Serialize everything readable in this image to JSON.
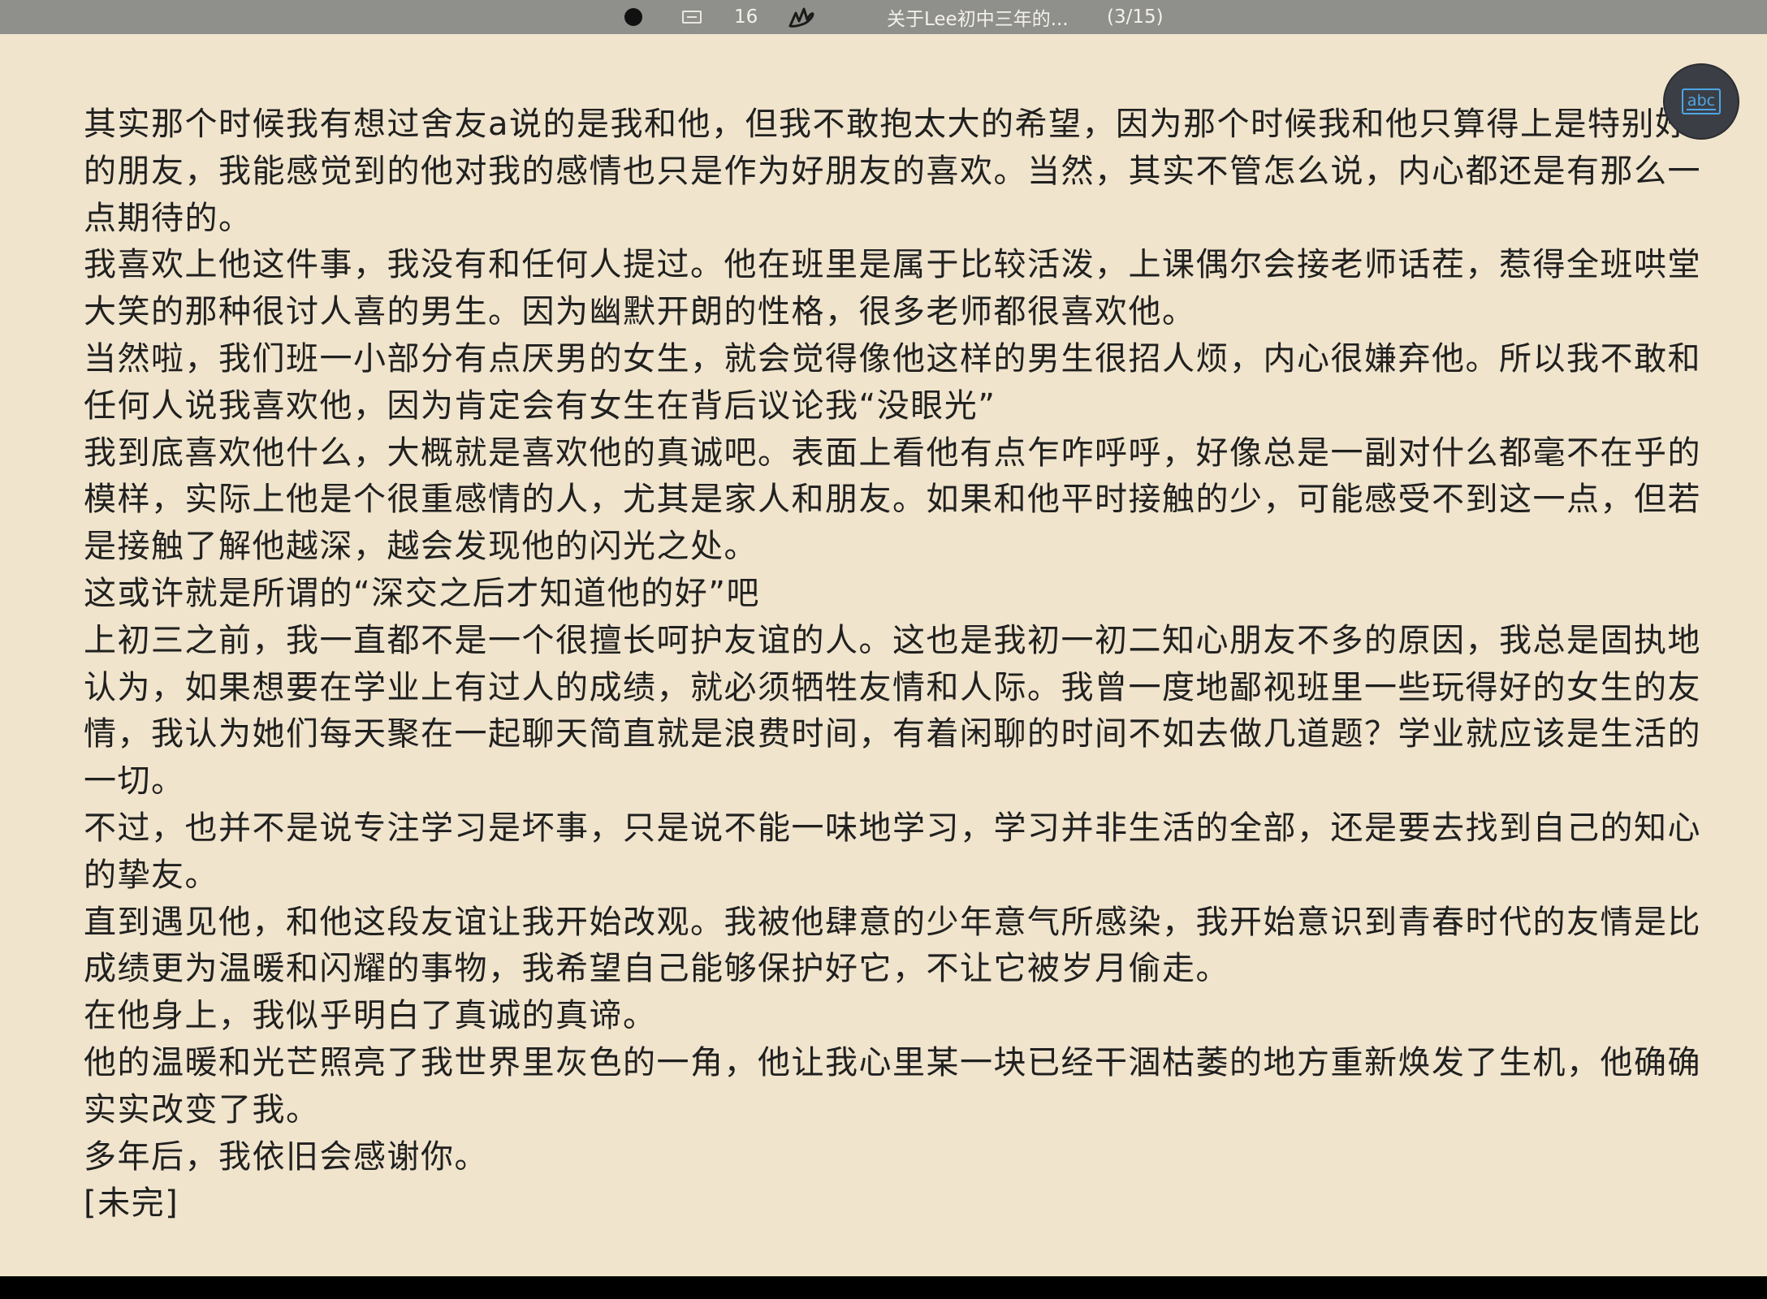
{
  "status_bar": {
    "signature_count": "16",
    "document_title": "关于Lee初中三年的...",
    "page_indicator": "(3/15)"
  },
  "float_button": {
    "label": "abc",
    "icon": "text-recognition-icon",
    "accent_color": "#4ea6e6"
  },
  "content": {
    "paragraphs": [
      "其实那个时候我有想过舍友a说的是我和他，但我不敢抱太大的希望，因为那个时候我和他只算得上是特别好的朋友，我能感觉到的他对我的感情也只是作为好朋友的喜欢。当然，其实不管怎么说，内心都还是有那么一点期待的。",
      "我喜欢上他这件事，我没有和任何人提过。他在班里是属于比较活泼，上课偶尔会接老师话茬，惹得全班哄堂大笑的那种很讨人喜的男生。因为幽默开朗的性格，很多老师都很喜欢他。",
      "当然啦，我们班一小部分有点厌男的女生，就会觉得像他这样的男生很招人烦，内心很嫌弃他。所以我不敢和任何人说我喜欢他，因为肯定会有女生在背后议论我“没眼光”",
      "我到底喜欢他什么，大概就是喜欢他的真诚吧。表面上看他有点乍咋呼呼，好像总是一副对什么都毫不在乎的模样，实际上他是个很重感情的人，尤其是家人和朋友。如果和他平时接触的少，可能感受不到这一点，但若是接触了解他越深，越会发现他的闪光之处。",
      "这或许就是所谓的“深交之后才知道他的好”吧",
      "上初三之前，我一直都不是一个很擅长呵护友谊的人。这也是我初一初二知心朋友不多的原因，我总是固执地认为，如果想要在学业上有过人的成绩，就必须牺牲友情和人际。我曾一度地鄙视班里一些玩得好的女生的友情，我认为她们每天聚在一起聊天简直就是浪费时间，有着闲聊的时间不如去做几道题？学业就应该是生活的一切。",
      "不过，也并不是说专注学习是坏事，只是说不能一味地学习，学习并非生活的全部，还是要去找到自己的知心的挚友。",
      "直到遇见他，和他这段友谊让我开始改观。我被他肆意的少年意气所感染，我开始意识到青春时代的友情是比成绩更为温暖和闪耀的事物，我希望自己能够保护好它，不让它被岁月偷走。",
      "在他身上，我似乎明白了真诚的真谛。",
      "他的温暖和光芒照亮了我世界里灰色的一角，他让我心里某一块已经干涸枯萎的地方重新焕发了生机，他确确实实改变了我。",
      "多年后，我依旧会感谢你。",
      "[未完]"
    ]
  }
}
